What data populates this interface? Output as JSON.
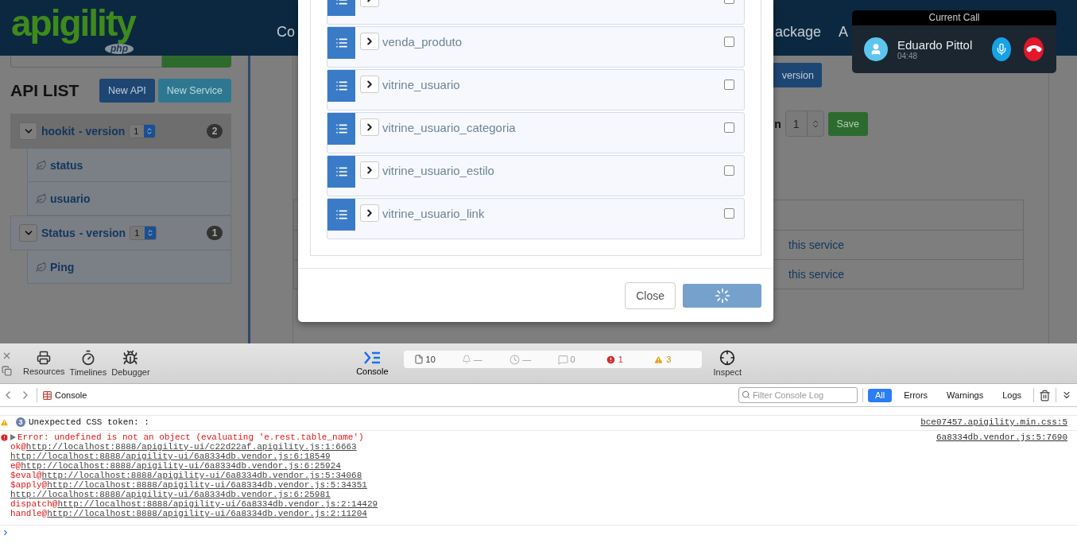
{
  "header": {
    "logo": "apigility",
    "logo_badge": "php",
    "nav": [
      "Co",
      "ackage",
      "A"
    ]
  },
  "sidebar": {
    "title": "API LIST",
    "buttons": [
      {
        "kind": "primary",
        "label": "New API"
      },
      {
        "kind": "info",
        "label": "New Service"
      }
    ],
    "apis": [
      {
        "name": "hookit",
        "version_label": "- version",
        "version": "1",
        "count": "2",
        "selected": true,
        "expanded": true,
        "services": [
          "status",
          "usuario"
        ]
      },
      {
        "name": "Status",
        "version_label": "- version",
        "version": "1",
        "count": "1",
        "selected": false,
        "expanded": true,
        "services": [
          "Ping"
        ]
      }
    ]
  },
  "main": {
    "new_version_button": "version",
    "version_label": "n",
    "version_value": "1",
    "save_button": "Save",
    "table_rows": [
      "this service",
      "this service"
    ]
  },
  "modal": {
    "tables": [
      {
        "checked": false
      },
      {
        "name": "venda_produto",
        "checked": false
      },
      {
        "name": "vitrine_usuario",
        "checked": false
      },
      {
        "name": "vitrine_usuario_categoria",
        "checked": false
      },
      {
        "name": "vitrine_usuario_estilo",
        "checked": false
      },
      {
        "name": "vitrine_usuario_link",
        "checked": false
      }
    ],
    "close_button": "Close",
    "loading": true
  },
  "call": {
    "title": "Current Call",
    "name": "Eduardo Pittol",
    "time": "04:48"
  },
  "devtools": {
    "tabs": [
      {
        "kind": "resources",
        "label": "Resources",
        "selected": false
      },
      {
        "kind": "timelines",
        "label": "Timelines",
        "selected": false
      },
      {
        "kind": "debugger",
        "label": "Debugger",
        "selected": false
      },
      {
        "kind": "console",
        "label": "Console",
        "selected": true
      }
    ],
    "counters": [
      {
        "kind": "resources",
        "value": "10"
      },
      {
        "kind": "network",
        "value": "—"
      },
      {
        "kind": "time",
        "value": "—"
      },
      {
        "kind": "logs",
        "value": "0"
      },
      {
        "kind": "errors",
        "value": "1"
      },
      {
        "kind": "warnings",
        "value": "3"
      }
    ],
    "inspect": "Inspect",
    "breadcrumb": "Console",
    "filter_placeholder": "Filter Console Log",
    "filters": [
      {
        "label": "All",
        "selected": true
      },
      {
        "label": "Errors",
        "selected": false
      },
      {
        "label": "Warnings",
        "selected": false
      },
      {
        "label": "Logs",
        "selected": false
      }
    ],
    "messages": [
      {
        "kind": "warning",
        "count": "3",
        "text": "Unexpected CSS token: :",
        "source": "bce07457.apigility.min.css:5"
      },
      {
        "kind": "error",
        "text": "Error: undefined is not an object (evaluating 'e.rest.table_name')",
        "source": "6a8334db.vendor.js:5:7690",
        "stack": [
          {
            "fn": "ok@",
            "url": "http://localhost:8888/apigility-ui/c22d22af.apigility.js:1:6663"
          },
          {
            "url": "http://localhost:8888/apigility-ui/6a8334db.vendor.js:6:18549"
          },
          {
            "fn": "e@",
            "url": "http://localhost:8888/apigility-ui/6a8334db.vendor.js:6:25924"
          },
          {
            "fn": "$eval@",
            "url": "http://localhost:8888/apigility-ui/6a8334db.vendor.js:5:34068"
          },
          {
            "fn": "$apply@",
            "url": "http://localhost:8888/apigility-ui/6a8334db.vendor.js:5:34351"
          },
          {
            "url": "http://localhost:8888/apigility-ui/6a8334db.vendor.js:6:25981"
          },
          {
            "fn": "dispatch@",
            "url": "http://localhost:8888/apigility-ui/6a8334db.vendor.js:2:14429"
          },
          {
            "fn": "handle@",
            "url": "http://localhost:8888/apigility-ui/6a8334db.vendor.js:2:11204"
          }
        ]
      }
    ]
  }
}
